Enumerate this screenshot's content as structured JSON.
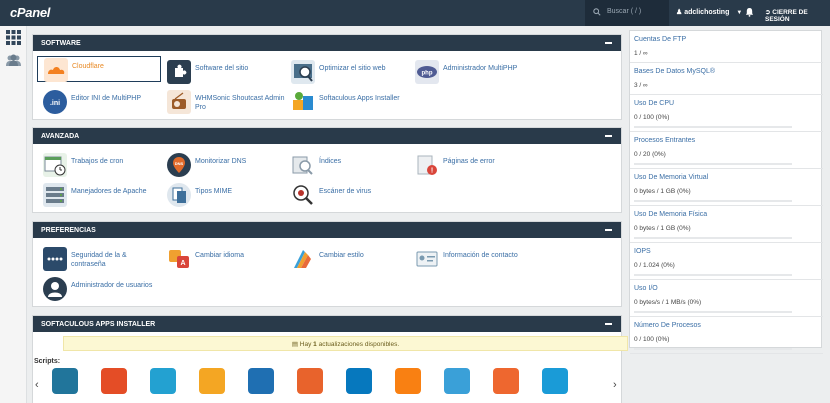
{
  "topbar": {
    "logo": "cPanel",
    "search_placeholder": "Buscar ( / )",
    "username": "adclichosting",
    "logout": "CIERRE DE SESIÓN"
  },
  "rail": {
    "icons": [
      "grid-icon",
      "users-icon"
    ]
  },
  "software": {
    "title": "SOFTWARE",
    "items": [
      {
        "label": "Cloudflare",
        "icon": "cloudflare-icon",
        "color": "#f38020"
      },
      {
        "label": "Software del sitio",
        "icon": "puzzle-icon",
        "color": "#2b3e50"
      },
      {
        "label": "Optimizar el sitio web",
        "icon": "optimize-icon",
        "color": "#4a6f8a"
      },
      {
        "label": "Administrador MultiPHP",
        "icon": "php-icon",
        "color": "#4f5b93"
      },
      {
        "label": "Editor INI de MultiPHP",
        "icon": "ini-icon",
        "color": "#2c5d9e"
      },
      {
        "label": "WHMSonic Shoutcast Admin Pro",
        "icon": "radio-icon",
        "color": "#9c5b28"
      },
      {
        "label": "Softaculous Apps Installer",
        "icon": "softaculous-icon",
        "color": "#2a8bd0"
      }
    ]
  },
  "avanzada": {
    "title": "AVANZADA",
    "items": [
      {
        "label": "Trabajos de cron",
        "icon": "cron-icon",
        "color": "#5a9e5a"
      },
      {
        "label": "Monitorizar DNS",
        "icon": "dns-icon",
        "color": "#e06a2a"
      },
      {
        "label": "Índices",
        "icon": "indices-icon",
        "color": "#8a9aa8"
      },
      {
        "label": "Páginas de error",
        "icon": "error-pages-icon",
        "color": "#d9453a"
      },
      {
        "label": "Manejadores de Apache",
        "icon": "apache-icon",
        "color": "#c0d0de"
      },
      {
        "label": "Tipos MIME",
        "icon": "mime-icon",
        "color": "#3d6f9a"
      },
      {
        "label": "Escáner de virus",
        "icon": "virus-scanner-icon",
        "color": "#b8322a"
      }
    ]
  },
  "preferencias": {
    "title": "PREFERENCIAS",
    "items": [
      {
        "label": "Seguridad de la & contraseña",
        "icon": "password-icon",
        "color": "#2b4a6a"
      },
      {
        "label": "Cambiar idioma",
        "icon": "language-icon",
        "color": "#f0a030"
      },
      {
        "label": "Cambiar estilo",
        "icon": "style-icon",
        "color": "#e86a3a"
      },
      {
        "label": "Información de contacto",
        "icon": "contact-icon",
        "color": "#7a9ab0"
      },
      {
        "label": "Administrador de usuarios",
        "icon": "user-manager-icon",
        "color": "#2b3e50"
      }
    ]
  },
  "softaculous": {
    "title": "SOFTACULOUS APPS INSTALLER",
    "notice_pre": "Hay",
    "notice_count": "1",
    "notice_post": "actualizaciones disponibles.",
    "scripts_label": "Scripts:",
    "apps": [
      {
        "icon": "wordpress-icon",
        "color": "#21759b"
      },
      {
        "icon": "joomla-icon",
        "color": "#e44d26"
      },
      {
        "icon": "opencart-icon",
        "color": "#23a1d1"
      },
      {
        "icon": "pinwheel-icon",
        "color": "#f4a623"
      },
      {
        "icon": "d-logo-icon",
        "color": "#1f6fb2"
      },
      {
        "icon": "kangaroo-icon",
        "color": "#e8632c"
      },
      {
        "icon": "drupal-icon",
        "color": "#0678be"
      },
      {
        "icon": "moodle-icon",
        "color": "#f98012"
      },
      {
        "icon": "chat-icon",
        "color": "#3aa0d8"
      },
      {
        "icon": "magento-icon",
        "color": "#ee672f"
      },
      {
        "icon": "parrot-icon",
        "color": "#1a9bd7"
      }
    ]
  },
  "stats": [
    {
      "title": "Cuentas De FTP",
      "value": "1 / ∞",
      "fill": null
    },
    {
      "title": "Bases De Datos MySQL®",
      "value": "3 / ∞",
      "fill": null
    },
    {
      "title": "Uso De CPU",
      "value": "0 / 100   (0%)",
      "fill": 0
    },
    {
      "title": "Procesos Entrantes",
      "value": "0 / 20   (0%)",
      "fill": 0
    },
    {
      "title": "Uso De Memoria Virtual",
      "value": "0 bytes / 1 GB   (0%)",
      "fill": 0
    },
    {
      "title": "Uso De Memoria Física",
      "value": "0 bytes / 1 GB   (0%)",
      "fill": 0
    },
    {
      "title": "IOPS",
      "value": "0 / 1.024   (0%)",
      "fill": 0
    },
    {
      "title": "Uso I/O",
      "value": "0 bytes/s / 1 MB/s   (0%)",
      "fill": 0
    },
    {
      "title": "Número De Procesos",
      "value": "0 / 100   (0%)",
      "fill": 0
    }
  ]
}
